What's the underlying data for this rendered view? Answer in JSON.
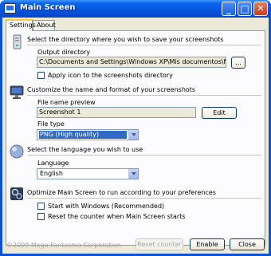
{
  "window": {
    "title": "Main Screen",
    "controls": {
      "minimize": "_",
      "maximize": "□",
      "close": "✕"
    }
  },
  "tabs": [
    {
      "label": "Settings",
      "active": true
    },
    {
      "label": "About",
      "active": false
    }
  ],
  "save_section": {
    "heading": "Select the directory where you wish to save your screenshots",
    "output_label": "Output directory",
    "output_value": "C:\\Documents and Settings\\Windows XP\\Mis documentos\\Mis imágenes\\",
    "browse_label": "...",
    "apply_icon_label": "Apply icon to the screenshots directory",
    "apply_icon_checked": false
  },
  "name_section": {
    "heading": "Customize the name and format of your screenshots",
    "preview_label": "File name preview",
    "preview_value": "Screenshot 1",
    "edit_label": "Edit",
    "type_label": "File type",
    "type_value": "PNG (High quality)"
  },
  "language_section": {
    "heading": "Select the language you wish to use",
    "language_label": "Language",
    "language_value": "English"
  },
  "optimize_section": {
    "heading": "Optimize Main Screen to run according to your preferences",
    "start_windows_label": "Start with Windows (Recommended)",
    "start_windows_checked": false,
    "reset_counter_label": "Reset the counter when Main Screen starts",
    "reset_counter_checked": false
  },
  "footer": {
    "copyright": "©2009 Mega Fantasma Corporation",
    "reset_counter_button": "Reset counter",
    "enable_button": "Enable",
    "close_button": "Close"
  },
  "icons": {
    "title": "screenshot-app-icon",
    "save": "computer-tower-icon",
    "name": "monitor-icon",
    "language": "globe-icon",
    "optimize": "gears-icon"
  },
  "colors": {
    "titlebar": "#0553dd",
    "client": "#ece9d8",
    "selection": "#316ac5"
  }
}
